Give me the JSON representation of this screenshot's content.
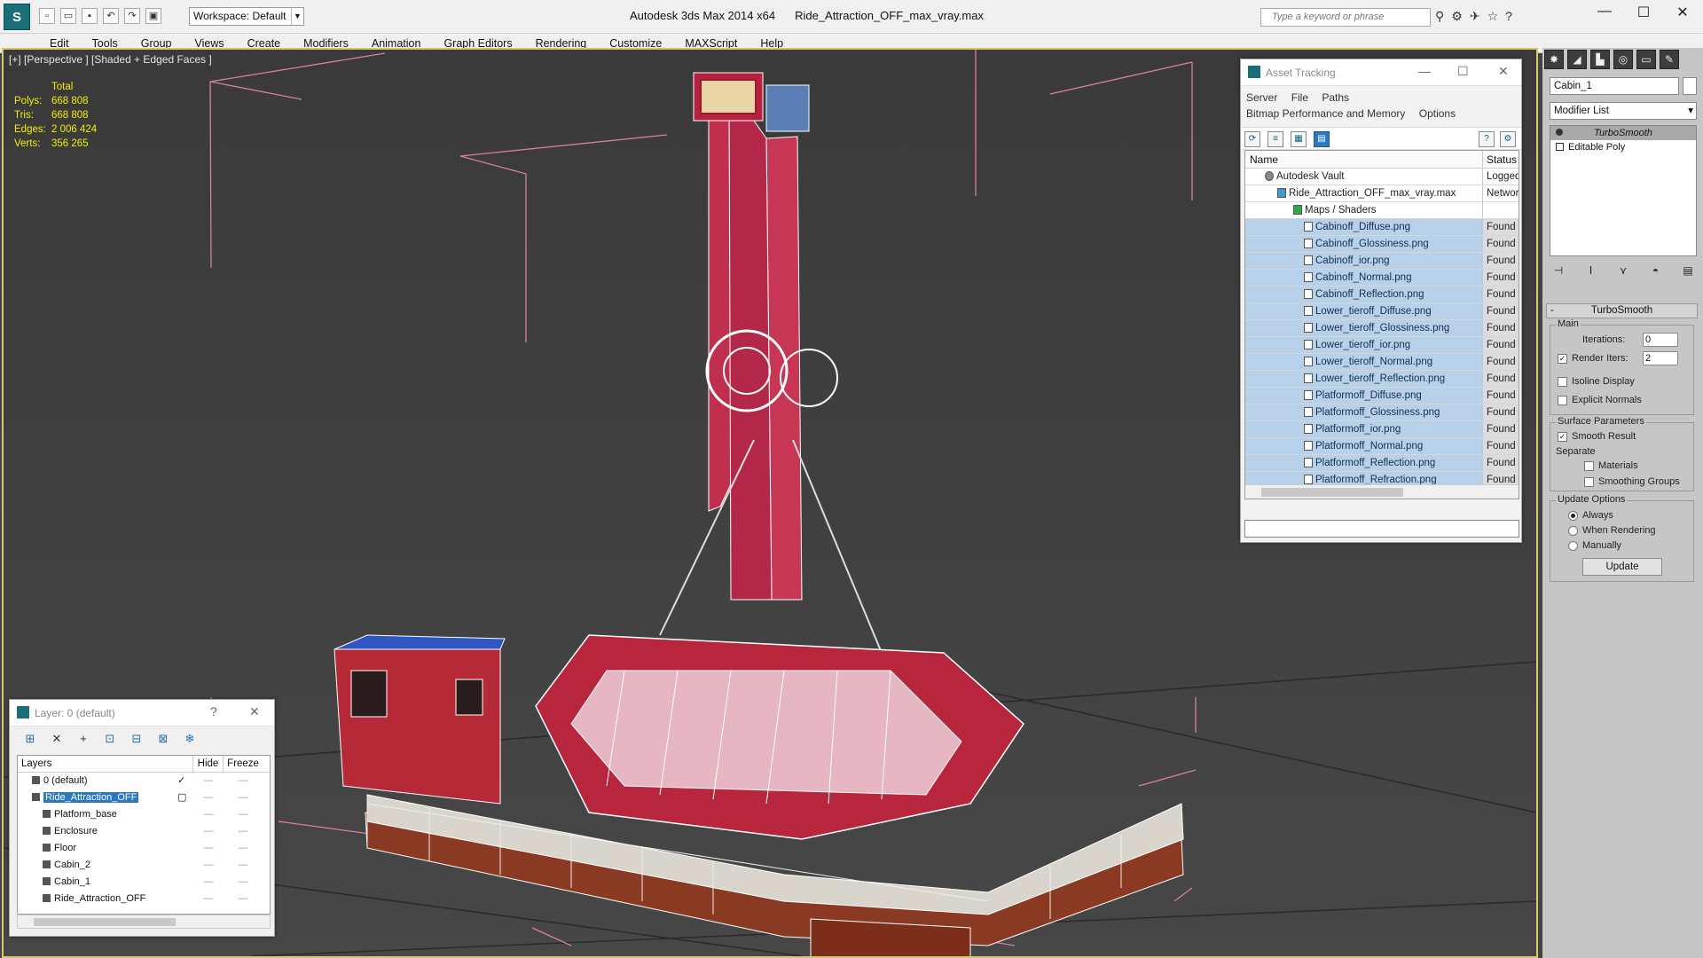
{
  "app": {
    "title_app": "Autodesk 3ds Max  2014 x64",
    "title_file": "Ride_Attraction_OFF_max_vray.max",
    "workspace": "Workspace: Default",
    "search_placeholder": "Type a keyword or phrase"
  },
  "menu": [
    "Edit",
    "Tools",
    "Group",
    "Views",
    "Create",
    "Modifiers",
    "Animation",
    "Graph Editors",
    "Rendering",
    "Customize",
    "MAXScript",
    "Help"
  ],
  "viewport": {
    "label": "[+] [Perspective ] [Shaded + Edged Faces ]",
    "stats": {
      "header": "Total",
      "rows": [
        {
          "k": "Polys:",
          "v": "668 808"
        },
        {
          "k": "Tris:",
          "v": "668 808"
        },
        {
          "k": "Edges:",
          "v": "2 006 424"
        },
        {
          "k": "Verts:",
          "v": "356 265"
        }
      ]
    }
  },
  "asset_tracking": {
    "title": "Asset Tracking",
    "menu1": [
      "Server",
      "File",
      "Paths"
    ],
    "menu2": [
      "Bitmap Performance and Memory",
      "Options"
    ],
    "col_name": "Name",
    "col_status": "Status",
    "vault": {
      "name": "Autodesk Vault",
      "status": "Logged"
    },
    "file": {
      "name": "Ride_Attraction_OFF_max_vray.max",
      "status": "Networ"
    },
    "group": {
      "name": "Maps / Shaders",
      "status": ""
    },
    "maps": [
      {
        "name": "Cabinoff_Diffuse.png",
        "status": "Found"
      },
      {
        "name": "Cabinoff_Glossiness.png",
        "status": "Found"
      },
      {
        "name": "Cabinoff_ior.png",
        "status": "Found"
      },
      {
        "name": "Cabinoff_Normal.png",
        "status": "Found"
      },
      {
        "name": "Cabinoff_Reflection.png",
        "status": "Found"
      },
      {
        "name": "Lower_tieroff_Diffuse.png",
        "status": "Found"
      },
      {
        "name": "Lower_tieroff_Glossiness.png",
        "status": "Found"
      },
      {
        "name": "Lower_tieroff_ior.png",
        "status": "Found"
      },
      {
        "name": "Lower_tieroff_Normal.png",
        "status": "Found"
      },
      {
        "name": "Lower_tieroff_Reflection.png",
        "status": "Found"
      },
      {
        "name": "Platformoff_Diffuse.png",
        "status": "Found"
      },
      {
        "name": "Platformoff_Glossiness.png",
        "status": "Found"
      },
      {
        "name": "Platformoff_ior.png",
        "status": "Found"
      },
      {
        "name": "Platformoff_Normal.png",
        "status": "Found"
      },
      {
        "name": "Platformoff_Reflection.png",
        "status": "Found"
      },
      {
        "name": "Platformoff_Refraction.png",
        "status": "Found"
      }
    ]
  },
  "command_panel": {
    "object_name": "Cabin_1",
    "modifier_list": "Modifier List",
    "stack": [
      "TurboSmooth",
      "Editable Poly"
    ],
    "rollout_title": "TurboSmooth",
    "main_label": "Main",
    "iterations_label": "Iterations:",
    "iterations_value": "0",
    "render_iters_label": "Render Iters:",
    "render_iters_value": "2",
    "isoline": "Isoline Display",
    "explicit_normals": "Explicit Normals",
    "surface_params": "Surface Parameters",
    "smooth_result": "Smooth Result",
    "separate": "Separate",
    "materials": "Materials",
    "smoothing_groups": "Smoothing Groups",
    "update_options": "Update Options",
    "always": "Always",
    "when_rendering": "When Rendering",
    "manually": "Manually",
    "update_button": "Update"
  },
  "layers": {
    "title": "Layer: 0 (default)",
    "col_layers": "Layers",
    "col_hide": "Hide",
    "col_freeze": "Freeze",
    "rows": [
      {
        "name": "0 (default)"
      },
      {
        "name": "Ride_Attraction_OFF"
      },
      {
        "name": "Platform_base"
      },
      {
        "name": "Enclosure"
      },
      {
        "name": "Floor"
      },
      {
        "name": "Cabin_2"
      },
      {
        "name": "Cabin_1"
      },
      {
        "name": "Ride_Attraction_OFF"
      }
    ]
  }
}
